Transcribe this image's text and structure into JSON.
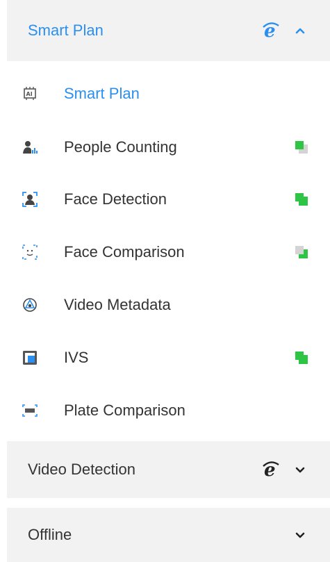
{
  "groups": [
    {
      "label": "Smart Plan",
      "state": "expanded",
      "icon": "ie-browser-icon",
      "chevron": "chevron-up-icon",
      "items": [
        {
          "label": "Smart Plan",
          "icon": "ai-chip-icon",
          "selected": true,
          "status": null
        },
        {
          "label": "People Counting",
          "icon": "people-counting-icon",
          "status": "gray"
        },
        {
          "label": "Face Detection",
          "icon": "face-detection-icon",
          "status": "green"
        },
        {
          "label": "Face Comparison",
          "icon": "face-comparison-icon",
          "status": "green"
        },
        {
          "label": "Video Metadata",
          "icon": "video-metadata-icon",
          "status": null
        },
        {
          "label": "IVS",
          "icon": "ivs-icon",
          "status": "green"
        },
        {
          "label": "Plate Comparison",
          "icon": "plate-comparison-icon",
          "status": null
        }
      ]
    },
    {
      "label": "Video Detection",
      "state": "collapsed",
      "icon": "ie-browser-icon",
      "chevron": "chevron-down-icon"
    },
    {
      "label": "Offline",
      "state": "collapsed",
      "chevron": "chevron-down-icon"
    }
  ],
  "colors": {
    "accent": "#2b8ff0",
    "status_green": "#2ec545",
    "status_gray": "#d4d4d4",
    "header_bg": "#f2f2f2"
  }
}
